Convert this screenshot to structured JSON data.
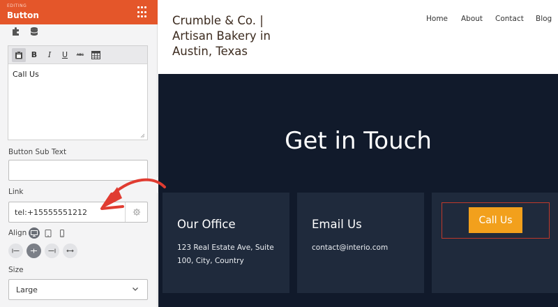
{
  "panel": {
    "eyebrow": "EDITING",
    "title": "Button",
    "accent_color": "#e4562a",
    "editor": {
      "toolbar_icons": [
        "paste-icon",
        "bold",
        "italic",
        "underline",
        "strikethrough",
        "table-icon"
      ],
      "bold": "B",
      "italic": "I",
      "underline": "U",
      "strike": "ABC",
      "content": "Call Us"
    },
    "sub_text": {
      "label": "Button Sub Text",
      "value": ""
    },
    "link": {
      "label": "Link",
      "value": "tel:+15555551212"
    },
    "align": {
      "label": "Align",
      "devices": [
        "desktop",
        "tablet",
        "mobile"
      ],
      "active_device": "desktop",
      "options": [
        "left",
        "center",
        "right",
        "full"
      ],
      "selected": "center"
    },
    "size": {
      "label": "Size",
      "value": "Large"
    }
  },
  "site": {
    "brand": "Crumble & Co. | Artisan Bakery in Austin, Texas",
    "nav": [
      "Home",
      "About",
      "Contact",
      "Blog"
    ],
    "hero": {
      "title": "Get in Touch",
      "background": "#111a2b",
      "cards": [
        {
          "title": "Our Office",
          "body": "123 Real Estate Ave, Suite 100, City, Country"
        },
        {
          "title": "Email Us",
          "body": "contact@interio.com"
        }
      ],
      "button": {
        "label": "Call Us",
        "color": "#f2a01c",
        "frame_color": "#c0392b"
      }
    }
  },
  "annotation": {
    "arrow_color": "#e03c31"
  }
}
